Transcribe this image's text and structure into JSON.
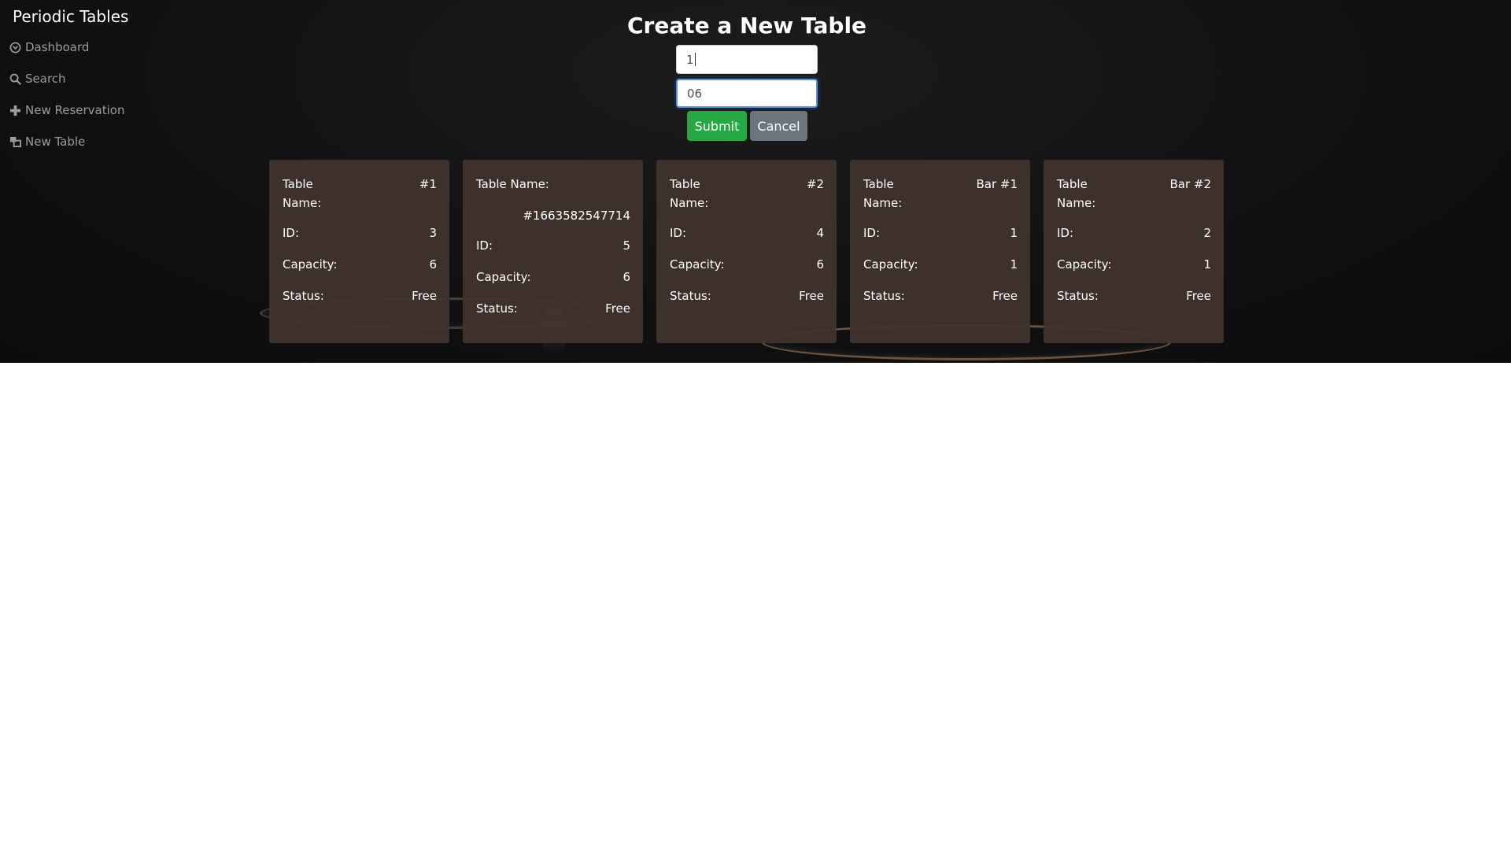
{
  "app": {
    "title": "Periodic Tables"
  },
  "nav": {
    "dashboard": "Dashboard",
    "search": "Search",
    "new_reservation": "New Reservation",
    "new_table": "New Table"
  },
  "form": {
    "title": "Create a New Table",
    "table_name_value": "1",
    "capacity_value": "06",
    "submit_label": "Submit",
    "cancel_label": "Cancel"
  },
  "labels": {
    "table_name": "Table Name:",
    "id": "ID:",
    "capacity": "Capacity:",
    "status": "Status:"
  },
  "tables": [
    {
      "name": "#1",
      "id": "3",
      "capacity": "6",
      "status": "Free"
    },
    {
      "name": "#1663582547714",
      "id": "5",
      "capacity": "6",
      "status": "Free"
    },
    {
      "name": "#2",
      "id": "4",
      "capacity": "6",
      "status": "Free"
    },
    {
      "name": "Bar #1",
      "id": "1",
      "capacity": "1",
      "status": "Free"
    },
    {
      "name": "Bar #2",
      "id": "2",
      "capacity": "1",
      "status": "Free"
    }
  ],
  "colors": {
    "header_bg": "#111111",
    "card_bg": "#42342e",
    "submit": "#28a745",
    "cancel": "#6c757d",
    "nav_text": "#9b9b9b"
  }
}
